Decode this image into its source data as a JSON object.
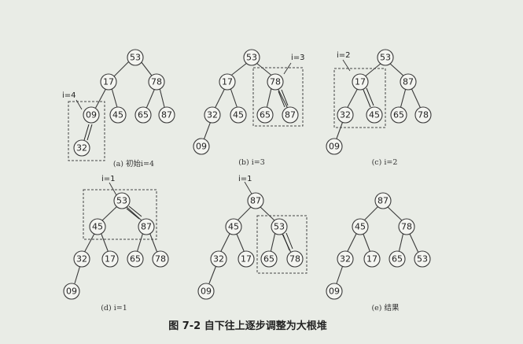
{
  "figure_title": "图 7-2    自下往上逐步调整为大根堆",
  "subfigures": [
    {
      "id": "a",
      "caption": "(a)  初始i=4",
      "annotation": "i=4",
      "nodes": [
        "53",
        "17",
        "78",
        "09",
        "45",
        "65",
        "87",
        "32"
      ]
    },
    {
      "id": "b",
      "caption": "(b)  i=3",
      "annotation": "i=3",
      "nodes": [
        "53",
        "17",
        "78",
        "32",
        "45",
        "65",
        "87",
        "09"
      ]
    },
    {
      "id": "c",
      "caption": "(c)  i=2",
      "annotation": "i=2",
      "nodes": [
        "53",
        "17",
        "87",
        "32",
        "45",
        "65",
        "78",
        "09"
      ]
    },
    {
      "id": "d",
      "caption": "(d)  i=1",
      "annotation": "i=1",
      "nodes": [
        "53",
        "45",
        "87",
        "32",
        "17",
        "65",
        "78",
        "09"
      ]
    },
    {
      "id": "e1",
      "caption": "",
      "annotation": "i=1",
      "nodes": [
        "87",
        "45",
        "53",
        "32",
        "17",
        "65",
        "78",
        "09"
      ]
    },
    {
      "id": "e2",
      "caption": "(e)  结果",
      "annotation": "",
      "nodes": [
        "87",
        "45",
        "78",
        "32",
        "17",
        "65",
        "53",
        "09"
      ]
    }
  ]
}
